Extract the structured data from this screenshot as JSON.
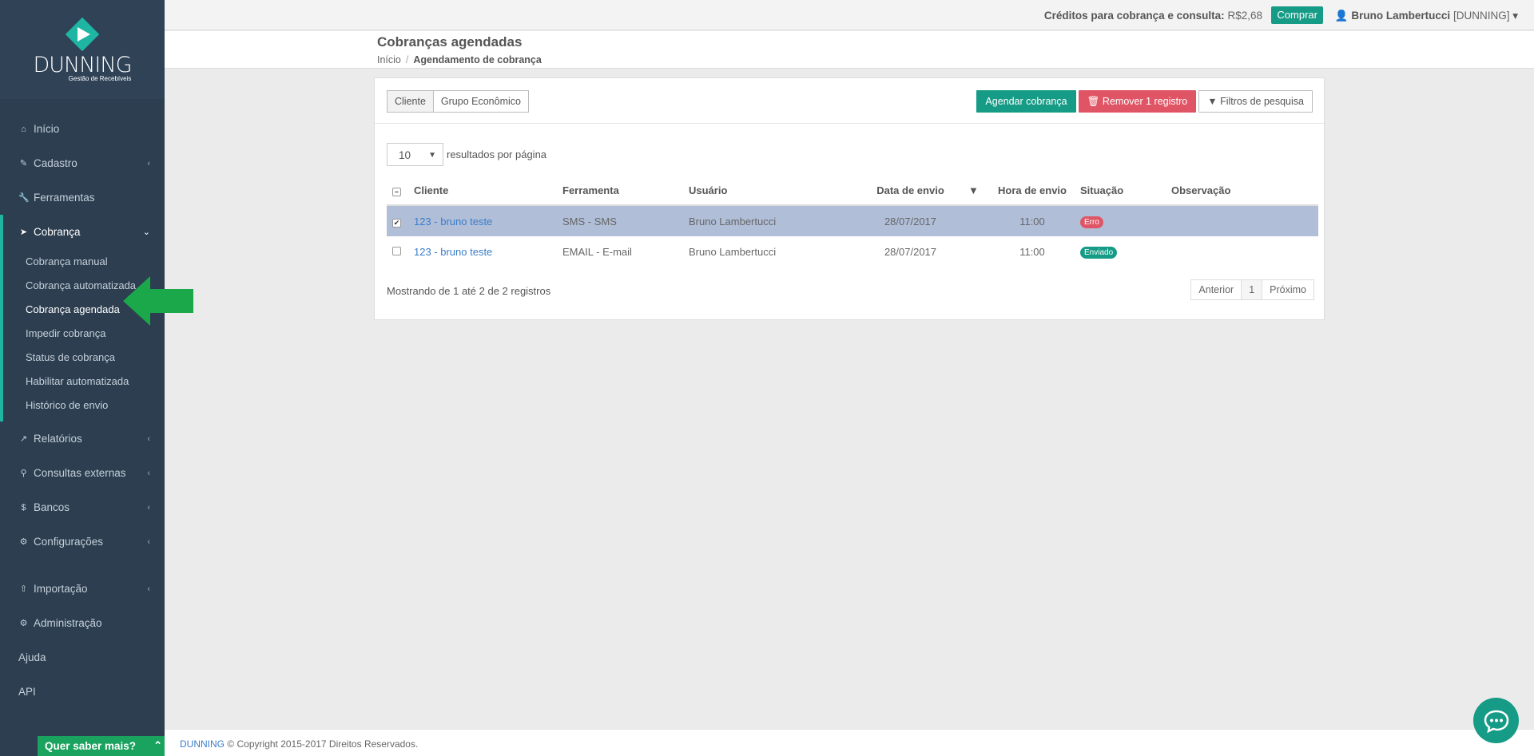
{
  "brand": {
    "logo_text": "DUNNING",
    "logo_subtitle": "Gestão de Recebíveis"
  },
  "sidebar": {
    "items": [
      {
        "label": "Início",
        "icon": "home-icon"
      },
      {
        "label": "Cadastro",
        "icon": "edit-icon"
      },
      {
        "label": "Ferramentas",
        "icon": "wrench-icon"
      },
      {
        "label": "Cobrança",
        "icon": "send-icon"
      },
      {
        "label": "Relatórios",
        "icon": "line-chart-icon"
      },
      {
        "label": "Consultas externas",
        "icon": "search-icon"
      },
      {
        "label": "Bancos",
        "icon": "dollar-icon"
      },
      {
        "label": "Configurações",
        "icon": "gear-icon"
      },
      {
        "label": "Importação",
        "icon": "upload-icon"
      },
      {
        "label": "Administração",
        "icon": "gears-icon"
      },
      {
        "label": "Ajuda"
      },
      {
        "label": "API"
      }
    ],
    "cobranca_submenu": [
      "Cobrança manual",
      "Cobrança automatizada",
      "Cobrança agendada",
      "Impedir cobrança",
      "Status de cobrança",
      "Habilitar automatizada",
      "Histórico de envio"
    ],
    "current_submenu": "Cobrança agendada"
  },
  "topbar": {
    "credits_label": "Créditos para cobrança e consulta:",
    "credits_value": "R$2,68",
    "buy_label": "Comprar",
    "user_name": "Bruno Lambertucci",
    "user_org": "[DUNNING]"
  },
  "header": {
    "title": "Cobranças agendadas",
    "breadcrumb_home": "Início",
    "breadcrumb_separator": "/",
    "breadcrumb_current": "Agendamento de cobrança"
  },
  "toolbar": {
    "seg_cliente": "Cliente",
    "seg_grupo": "Grupo Econômico",
    "schedule_label": "Agendar cobrança",
    "remove_label": "Remover 1 registro",
    "filters_label": "Filtros de pesquisa"
  },
  "pagination": {
    "per_page_value": "10",
    "per_page_label": "resultados por página",
    "summary": "Mostrando de 1 até 2 de 2 registros",
    "prev_label": "Anterior",
    "page": "1",
    "next_label": "Próximo"
  },
  "table": {
    "columns": [
      "Cliente",
      "Ferramenta",
      "Usuário",
      "Data de envio",
      "Hora de envio",
      "Situação",
      "Observação"
    ],
    "rows": [
      {
        "selected": true,
        "cliente": "123 - bruno teste",
        "ferramenta": "SMS - SMS",
        "usuario": "Bruno Lambertucci",
        "data": "28/07/2017",
        "hora": "11:00",
        "situacao": "Erro",
        "observacao": ""
      },
      {
        "selected": false,
        "cliente": "123 - bruno teste",
        "ferramenta": "EMAIL - E-mail",
        "usuario": "Bruno Lambertucci",
        "data": "28/07/2017",
        "hora": "11:00",
        "situacao": "Enviado",
        "observacao": ""
      }
    ]
  },
  "footer": {
    "brand": "DUNNING",
    "copyright": "© Copyright 2015-2017 Direitos Reservados."
  },
  "widget": {
    "quer_saber": "Quer saber mais?"
  },
  "colors": {
    "sidebar_bg": "#2c3e50",
    "accent": "#1fb5a3",
    "primary_button": "#169b86",
    "danger": "#e05565",
    "selected_row": "#b0bed8"
  }
}
